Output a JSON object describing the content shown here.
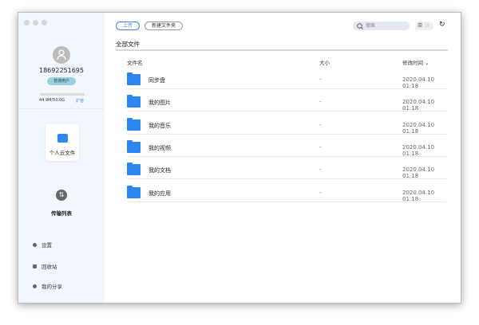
{
  "sidebar": {
    "phone": "18692251695",
    "badge": "普通用户",
    "quota": "44.9M/50.0G",
    "quota_fraction": 0.001,
    "expand": "扩容",
    "personal_files": "个人云文件",
    "transfer_list": "传输列表",
    "nav": [
      {
        "label": "设置",
        "icon": "gear-icon"
      },
      {
        "label": "回收站",
        "icon": "trash-icon"
      },
      {
        "label": "我的分享",
        "icon": "share-icon"
      }
    ]
  },
  "toolbar": {
    "upload": "上传",
    "new_folder": "新建文件夹",
    "search_placeholder": "搜索",
    "list_view": "☰",
    "grid_view": "⊞",
    "refresh": "↻"
  },
  "main": {
    "title": "全部文件",
    "columns": {
      "name": "文件名",
      "size": "大小",
      "modified": "修改时间 ⌄"
    },
    "files": [
      {
        "name": "同步盘",
        "size": "-",
        "modified": "2020.04.10 01:18"
      },
      {
        "name": "我的图片",
        "size": "-",
        "modified": "2020.04.10 01:18"
      },
      {
        "name": "我的音乐",
        "size": "-",
        "modified": "2020.04.10 01:18"
      },
      {
        "name": "我的视频",
        "size": "-",
        "modified": "2020.04.10 01:18"
      },
      {
        "name": "我的文档",
        "size": "-",
        "modified": "2020.04.10 01:18"
      },
      {
        "name": "我的应用",
        "size": "-",
        "modified": "2020.04.10 01:18"
      }
    ]
  }
}
